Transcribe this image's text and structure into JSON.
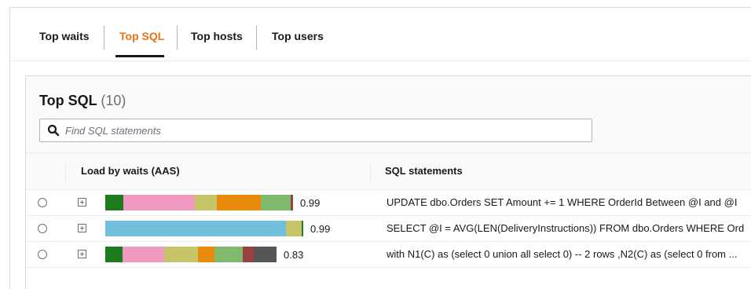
{
  "tabs": [
    {
      "label": "Top waits",
      "active": false
    },
    {
      "label": "Top SQL",
      "active": true
    },
    {
      "label": "Top hosts",
      "active": false
    },
    {
      "label": "Top users",
      "active": false
    }
  ],
  "panel": {
    "title": "Top SQL",
    "count": "(10)"
  },
  "search": {
    "placeholder": "Find SQL statements",
    "value": ""
  },
  "columns": {
    "load": "Load by waits (AAS)",
    "sql": "SQL statements"
  },
  "colors": {
    "accent": "#ec7211"
  },
  "rows": [
    {
      "load": "0.99",
      "sql": "UPDATE dbo.Orders SET Amount += 1 WHERE OrderId Between @I and @I",
      "segments": [
        {
          "color": "#1d7a1d",
          "share": 0.09
        },
        {
          "color": "#f19ac0",
          "share": 0.36
        },
        {
          "color": "#c7c56a",
          "share": 0.11
        },
        {
          "color": "#e88a0b",
          "share": 0.22
        },
        {
          "color": "#7fba6e",
          "share": 0.15
        },
        {
          "color": "#9b4040",
          "share": 0.01
        }
      ]
    },
    {
      "load": "0.99",
      "sql": "SELECT @I = AVG(LEN(DeliveryInstructions)) FROM dbo.Orders WHERE Ord",
      "segments": [
        {
          "color": "#71bfdc",
          "share": 0.905
        },
        {
          "color": "#c7c56a",
          "share": 0.08
        },
        {
          "color": "#2a7a2a",
          "share": 0.008
        }
      ]
    },
    {
      "load": "0.83",
      "sql": "with N1(C) as (select 0 union all select 0) -- 2 rows ,N2(C) as (select 0 from ...",
      "segments": [
        {
          "color": "#1d7a1d",
          "share": 0.0885
        },
        {
          "color": "#f19ac0",
          "share": 0.2085
        },
        {
          "color": "#c7c56a",
          "share": 0.1675
        },
        {
          "color": "#e88a0b",
          "share": 0.0833
        },
        {
          "color": "#7fba6e",
          "share": 0.141
        },
        {
          "color": "#9b4040",
          "share": 0.0565
        },
        {
          "color": "#555555",
          "share": 0.1145
        }
      ]
    }
  ]
}
